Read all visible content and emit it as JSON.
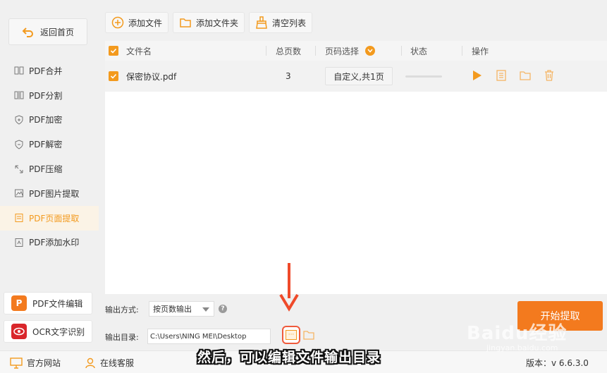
{
  "sidebar": {
    "back_label": "返回首页",
    "items": [
      {
        "label": "PDF合并",
        "icon": "merge-icon"
      },
      {
        "label": "PDF分割",
        "icon": "split-icon"
      },
      {
        "label": "PDF加密",
        "icon": "shield-plus-icon"
      },
      {
        "label": "PDF解密",
        "icon": "shield-icon"
      },
      {
        "label": "PDF压缩",
        "icon": "compress-icon"
      },
      {
        "label": "PDF图片提取",
        "icon": "image-icon"
      },
      {
        "label": "PDF页面提取",
        "icon": "page-extract-icon",
        "active": true
      },
      {
        "label": "PDF添加水印",
        "icon": "watermark-icon"
      }
    ],
    "promo_edit": {
      "label": "PDF文件编辑",
      "badge": "P"
    },
    "promo_ocr": {
      "label": "OCR文字识别"
    }
  },
  "toolbar": {
    "add_file": "添加文件",
    "add_folder": "添加文件夹",
    "clear_list": "清空列表"
  },
  "table": {
    "headers": {
      "filename": "文件名",
      "pages": "总页数",
      "page_select": "页码选择",
      "status": "状态",
      "actions": "操作"
    },
    "rows": [
      {
        "filename": "保密协议.pdf",
        "pages": "3",
        "page_select": "自定义,共1页",
        "checked": true
      }
    ]
  },
  "bottom": {
    "output_mode_label": "输出方式:",
    "output_mode_value": "按页数输出",
    "output_dir_label": "输出目录:",
    "output_dir_value": "C:\\Users\\NING MEI\\Desktop",
    "browse_label": "···",
    "start_label": "开始提取"
  },
  "footer": {
    "website": "官方网站",
    "support": "在线客服",
    "version": "版本：v 6.6.3.0"
  },
  "overlay": {
    "subtitle": "然后，可以编辑文件输出目录",
    "watermark": "Baidu经验",
    "watermark_url": "jingyan.baidu.com"
  },
  "colors": {
    "accent": "#f39a1e",
    "start": "#f37a1e",
    "highlight": "#ef5a3c"
  }
}
